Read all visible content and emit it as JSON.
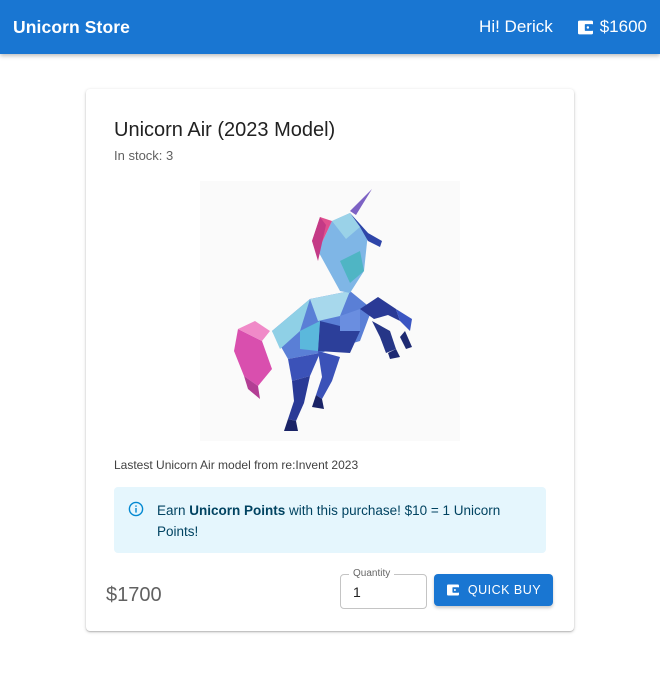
{
  "appbar": {
    "brand": "Unicorn Store",
    "greeting": "Hi! Derick",
    "wallet_balance": "$1600",
    "wallet_icon": "wallet-icon"
  },
  "product": {
    "title": "Unicorn Air (2023 Model)",
    "stock": "In stock: 3",
    "image_icon": "unicorn-image",
    "description": "Lastest Unicorn Air model from re:Invent 2023",
    "alert": {
      "icon": "info-icon",
      "prefix": "Earn ",
      "bold": "Unicorn Points",
      "suffix": " with this purchase! $10 = 1 Unicorn Points!"
    },
    "price": "$1700",
    "quantity_label": "Quantity",
    "quantity_value": "1",
    "buy_label": "QUICK BUY"
  },
  "colors": {
    "primary": "#1976d2",
    "alert_bg": "#e5f6fd",
    "alert_text": "#014361"
  }
}
